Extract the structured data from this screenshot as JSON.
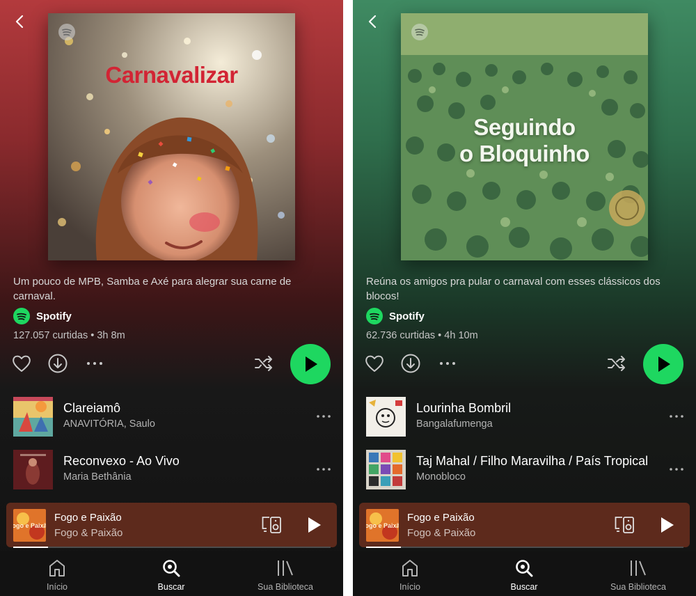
{
  "left": {
    "playlist": {
      "title": "Carnavalizar",
      "description": "Um pouco de MPB, Samba e Axé para alegrar sua carne de carnaval.",
      "owner": "Spotify",
      "meta": "127.057 curtidas • 3h 8m"
    },
    "tracks": [
      {
        "title": "Clareiamô",
        "artist": "ANAVITÓRIA, Saulo"
      },
      {
        "title": "Reconvexo - Ao Vivo",
        "artist": "Maria Bethânia"
      }
    ]
  },
  "right": {
    "playlist": {
      "title": "Seguindo\no Bloquinho",
      "description": "Reúna os amigos pra pular o carnaval com esses clássicos dos blocos!",
      "owner": "Spotify",
      "meta": "62.736 curtidas • 4h 10m"
    },
    "tracks": [
      {
        "title": "Lourinha Bombril",
        "artist": "Bangalafumenga"
      },
      {
        "title": "Taj Mahal / Filho Maravilha / País Tropical",
        "artist": "Monobloco"
      }
    ]
  },
  "mini_player": {
    "title": "Fogo e Paixão",
    "artist": "Fogo & Paixão",
    "art_text": "Fogo e Paixão",
    "progress": 0.11
  },
  "tabs": [
    {
      "label": "Início",
      "icon": "home-icon"
    },
    {
      "label": "Buscar",
      "icon": "search-icon",
      "active": true
    },
    {
      "label": "Sua Biblioteca",
      "icon": "library-icon"
    }
  ],
  "colors": {
    "accent_green": "#1ed760",
    "left_header": "#b33a3d",
    "right_header": "#3f8a62",
    "mini_player_bg": "#5d2a1c",
    "background": "#121212"
  }
}
